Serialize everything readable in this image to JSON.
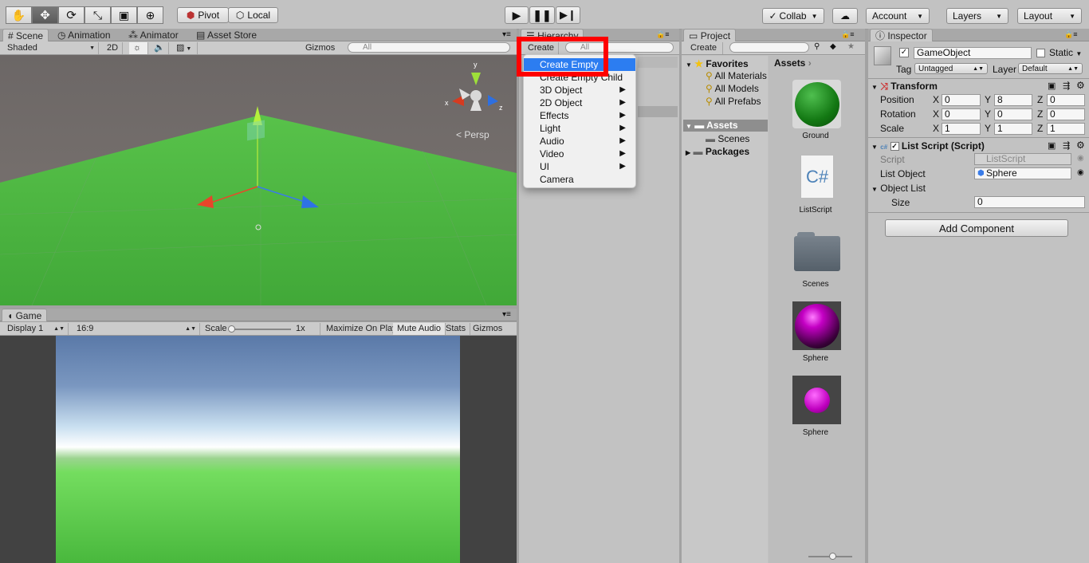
{
  "toolbar": {
    "pivot": "Pivot",
    "local": "Local",
    "collab": "Collab",
    "account": "Account",
    "layers": "Layers",
    "layout": "Layout"
  },
  "scene": {
    "tabs": [
      "Scene",
      "Animation",
      "Animator",
      "Asset Store"
    ],
    "shading": "Shaded",
    "mode2d": "2D",
    "gizmos": "Gizmos",
    "search_placeholder": "All",
    "persp": "Persp",
    "axis_x": "x",
    "axis_y": "y",
    "axis_z": "z"
  },
  "game": {
    "tab": "Game",
    "display": "Display 1",
    "aspect": "16:9",
    "scale_label": "Scale",
    "scale_value": "1x",
    "maximize": "Maximize On Play",
    "mute": "Mute Audio",
    "stats": "Stats",
    "gizmos": "Gizmos"
  },
  "hierarchy": {
    "tab": "Hierarchy",
    "create": "Create",
    "search_placeholder": "All"
  },
  "create_menu": {
    "items": [
      {
        "label": "Create Empty",
        "submenu": false,
        "selected": true
      },
      {
        "label": "Create Empty Child",
        "submenu": false,
        "selected": false
      },
      {
        "label": "3D Object",
        "submenu": true,
        "selected": false
      },
      {
        "label": "2D Object",
        "submenu": true,
        "selected": false
      },
      {
        "label": "Effects",
        "submenu": true,
        "selected": false
      },
      {
        "label": "Light",
        "submenu": true,
        "selected": false
      },
      {
        "label": "Audio",
        "submenu": true,
        "selected": false
      },
      {
        "label": "Video",
        "submenu": true,
        "selected": false
      },
      {
        "label": "UI",
        "submenu": true,
        "selected": false
      },
      {
        "label": "Camera",
        "submenu": false,
        "selected": false
      }
    ]
  },
  "project": {
    "tab": "Project",
    "create": "Create",
    "favorites": "Favorites",
    "fav_items": [
      "All Materials",
      "All Models",
      "All Prefabs"
    ],
    "assets_root": "Assets",
    "assets_children": [
      "Scenes"
    ],
    "packages": "Packages",
    "breadcrumb": "Assets",
    "assets": [
      {
        "name": "Ground",
        "icon": "green-sphere"
      },
      {
        "name": "ListScript",
        "icon": "csharp-script"
      },
      {
        "name": "Scenes",
        "icon": "folder"
      },
      {
        "name": "Sphere",
        "icon": "magenta-sphere-material"
      },
      {
        "name": "Sphere",
        "icon": "magenta-sphere-prefab"
      }
    ]
  },
  "inspector": {
    "tab": "Inspector",
    "object_name": "GameObject",
    "static": "Static",
    "tag_label": "Tag",
    "tag": "Untagged",
    "layer_label": "Layer",
    "layer": "Default",
    "transform": {
      "title": "Transform",
      "position": {
        "label": "Position",
        "x": "0",
        "y": "8",
        "z": "0"
      },
      "rotation": {
        "label": "Rotation",
        "x": "0",
        "y": "0",
        "z": "0"
      },
      "scale": {
        "label": "Scale",
        "x": "1",
        "y": "1",
        "z": "1"
      },
      "x": "X",
      "y": "Y",
      "z": "Z"
    },
    "script_component": {
      "title": "List Script (Script)",
      "script_label": "Script",
      "script_value": "ListScript",
      "list_object_label": "List Object",
      "list_object_value": "Sphere",
      "object_list_label": "Object List",
      "size_label": "Size",
      "size_value": "0"
    },
    "add_component": "Add Component"
  }
}
